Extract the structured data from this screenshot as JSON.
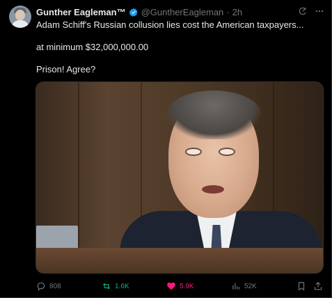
{
  "tweet": {
    "author_name": "Gunther Eagleman™",
    "handle": "@GuntherEagleman",
    "separator": "·",
    "time": "2h",
    "text_lines": [
      "Adam Schiff's Russian collusion lies cost the American taxpayers...",
      "at minimum $32,000,000.00",
      "Prison!  Agree?"
    ]
  },
  "actions": {
    "replies": "808",
    "reposts": "1.6K",
    "likes": "5.9K",
    "views": "52K"
  },
  "colors": {
    "background": "#000000",
    "text": "#e7e9ea",
    "muted": "#71767b",
    "verified": "#1d9bf0",
    "repost_active": "#00ba7c",
    "like_active": "#f91880"
  },
  "icons": {
    "verified": "verified-badge-icon",
    "grok": "grok-icon",
    "more": "more-icon",
    "reply": "reply-icon",
    "repost": "repost-icon",
    "like": "heart-icon",
    "views": "views-chart-icon",
    "bookmark": "bookmark-icon",
    "share": "share-icon"
  }
}
